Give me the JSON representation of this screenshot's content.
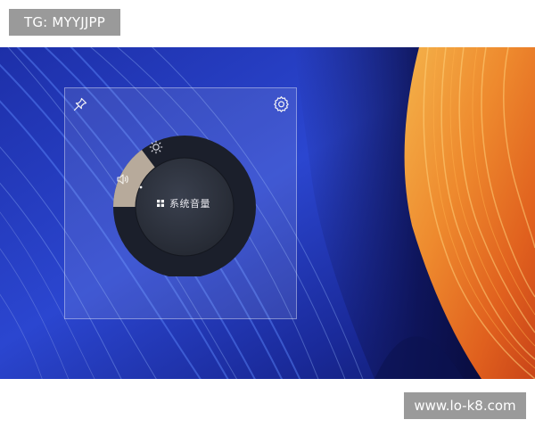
{
  "watermarks": {
    "top_left": "TG: MYYJJPP",
    "bottom_right": "www.lo-k8.com"
  },
  "volume_control": {
    "center_label": "系统音量",
    "segments": {
      "active": "volume",
      "top": "brightness"
    },
    "icons": {
      "pin": "pin-icon",
      "settings": "gear-icon",
      "brightness": "sun-icon",
      "volume": "speaker-icon",
      "center": "grid-icon"
    }
  },
  "colors": {
    "active_segment": "#b6aa9c",
    "dial_ring": "#1d2130",
    "dial_center": "#2a2f3b",
    "wallpaper_blue": "#2a3fc4",
    "wallpaper_orange": "#f08a2a"
  }
}
